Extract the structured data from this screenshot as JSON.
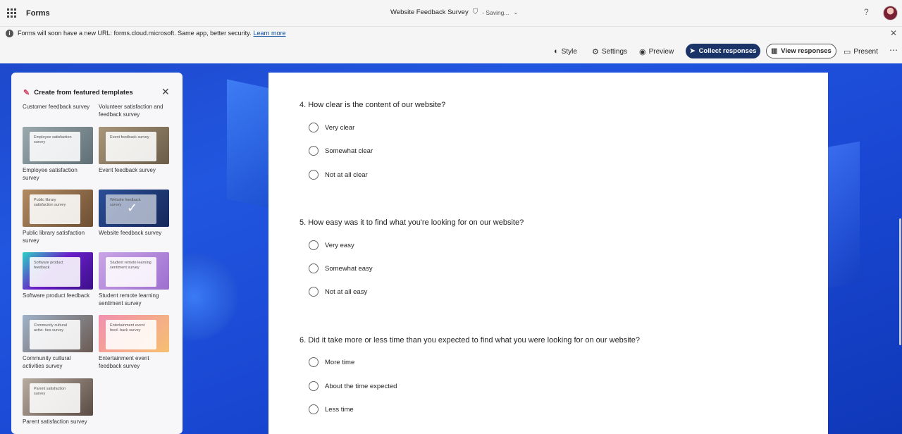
{
  "header": {
    "app_name": "Forms",
    "doc_title": "Website Feedback Survey",
    "save_status": "Saving...",
    "help": "?"
  },
  "notice": {
    "message": "Forms will soon have a new URL: forms.cloud.microsoft. Same app, better security.",
    "link": "Learn more"
  },
  "toolbar": {
    "style": "Style",
    "settings": "Settings",
    "preview": "Preview",
    "collect": "Collect responses",
    "view": "View responses",
    "present": "Present"
  },
  "templates": {
    "title": "Create from featured templates",
    "partial": [
      "Customer feedback survey",
      "Volunteer satisfaction and feedback survey"
    ],
    "items": [
      {
        "label": "Employee satisfaction survey",
        "thumb_text": "Employee satisfaction survey",
        "color": "#6b7e86"
      },
      {
        "label": "Event feedback survey",
        "thumb_text": "Event feedback survey",
        "color": "#8a7a5c"
      },
      {
        "label": "Public library satisfaction survey",
        "thumb_text": "Public library satisfaction survey",
        "color": "#8c6a48"
      },
      {
        "label": "Website feedback survey",
        "thumb_text": "Website feedback survey",
        "color": "#1f3d7a"
      },
      {
        "label": "Software product feedback",
        "thumb_text": "Software product feedback",
        "color": "#5a2aa8"
      },
      {
        "label": "Student remote learning sentiment survey",
        "thumb_text": "Student remote learning sentiment survey",
        "color": "#b58ad6"
      },
      {
        "label": "Community cultural activities survey",
        "thumb_text": "Community cultural activi- ties survey",
        "color": "#7f8ea2"
      },
      {
        "label": "Entertainment event feedback survey",
        "thumb_text": "Entertainment event feed- back survey",
        "color": "#e98aa0"
      },
      {
        "label": "Parent satisfaction survey",
        "thumb_text": "Parent satisfaction survey",
        "color": "#9a8f86"
      }
    ]
  },
  "questions": [
    {
      "text": "4. How clear is the content of our website?",
      "options": [
        "Very clear",
        "Somewhat clear",
        "Not at all clear"
      ]
    },
    {
      "text": "5. How easy was it to find what you're looking for on our website?",
      "options": [
        "Very easy",
        "Somewhat easy",
        "Not at all easy"
      ]
    },
    {
      "text": "6. Did it take more or less time than you expected to find what you were looking for on our website?",
      "options": [
        "More time",
        "About the time expected",
        "Less time"
      ]
    }
  ]
}
